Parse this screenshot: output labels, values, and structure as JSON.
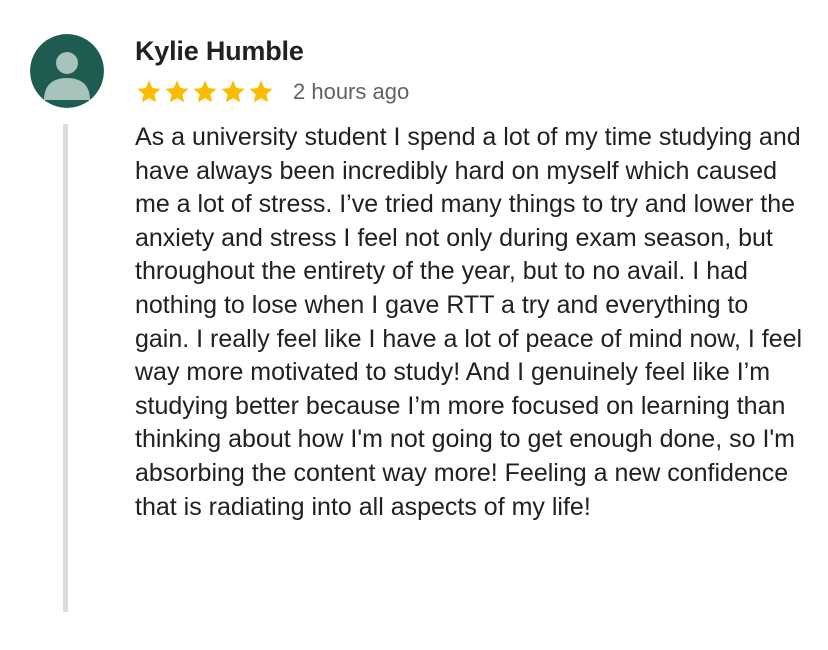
{
  "review": {
    "author": "Kylie Humble",
    "rating": 5,
    "rating_max": 5,
    "time": "2 hours ago",
    "text": "As a university student I spend a lot of my time studying and have always been incredibly hard on myself which caused me a lot of stress. I’ve tried many things to try and lower the anxiety and stress I feel not only during exam season, but throughout the entirety of the year, but to no avail. I had nothing to lose when I gave RTT a try and everything to gain. I really feel like I have a lot of peace of mind now, I feel way more motivated to study! And I genuinely feel like I’m studying better because I’m more focused on learning than thinking about how I'm not going to get enough done, so I'm absorbing the content way more! Feeling a new confidence that is radiating into all aspects of my life!",
    "avatar_icon": "default-person-avatar-icon",
    "star_icon": "star-icon"
  },
  "colors": {
    "avatar_bg": "#1e5b50",
    "avatar_figure": "#a7c3bb",
    "star": "#fbbc04",
    "text": "#202124",
    "secondary_text": "#5f6368",
    "divider": "#dadce0"
  }
}
